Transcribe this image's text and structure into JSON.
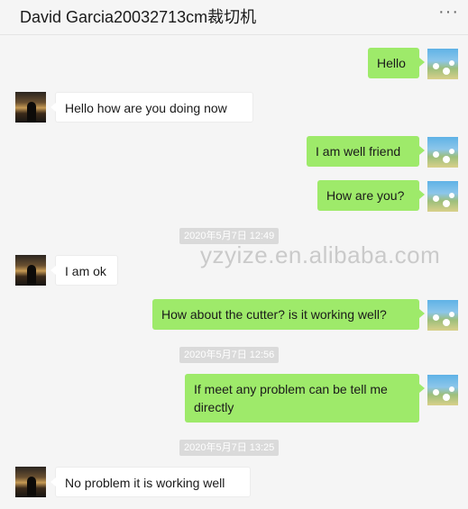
{
  "header": {
    "title": "David Garcia20032713cm裁切机",
    "more_icon": "···"
  },
  "watermark": "yzyize.en.alibaba.com",
  "colors": {
    "outgoing_bubble": "#9eea6a",
    "incoming_bubble": "#ffffff",
    "background": "#f5f5f5"
  },
  "messages": [
    {
      "from": "me",
      "text": "Hello"
    },
    {
      "from": "contact",
      "text": "Hello how are you doing now"
    },
    {
      "from": "me",
      "text": "I am well friend"
    },
    {
      "from": "me",
      "text": "How are you?"
    },
    {
      "timestamp": "2020年5月7日 12:49"
    },
    {
      "from": "contact",
      "text": "I am ok"
    },
    {
      "from": "me",
      "text": "How about the cutter? is it working well?"
    },
    {
      "timestamp": "2020年5月7日 12:56"
    },
    {
      "from": "me",
      "text": "If meet any problem can be tell me directly"
    },
    {
      "timestamp": "2020年5月7日 13:25"
    },
    {
      "from": "contact",
      "text": "No problem it is working well"
    }
  ]
}
